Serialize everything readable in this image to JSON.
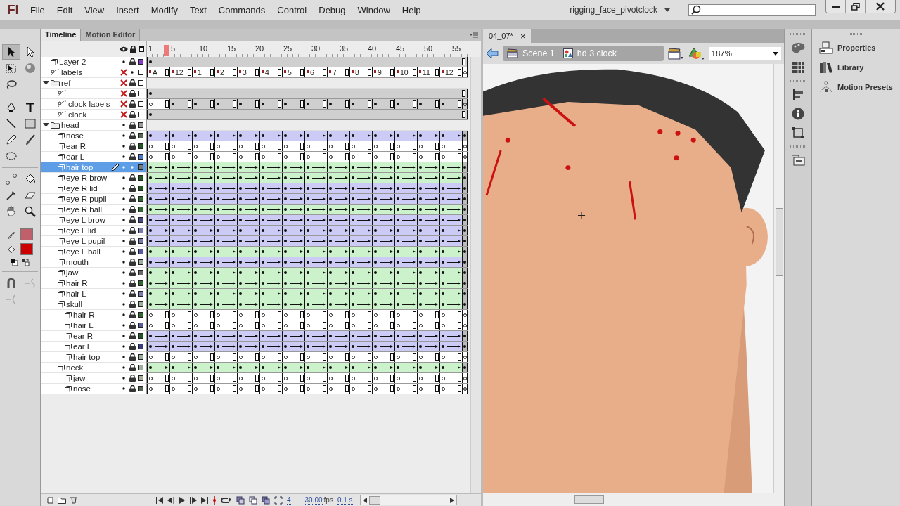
{
  "app": {
    "logo": "Fl",
    "menus": [
      "File",
      "Edit",
      "View",
      "Insert",
      "Modify",
      "Text",
      "Commands",
      "Control",
      "Debug",
      "Window",
      "Help"
    ],
    "workspace": "rigging_face_pivotclock"
  },
  "tools": {
    "stroke": {
      "color": "#c0606a"
    },
    "fill": {
      "color": "#cc0000"
    }
  },
  "timeline": {
    "tabs": [
      {
        "label": "Timeline",
        "selected": true
      },
      {
        "label": "Motion Editor",
        "selected": false
      }
    ],
    "ruler": [
      "1",
      "5",
      "10",
      "15",
      "20",
      "25",
      "30",
      "35",
      "40",
      "45",
      "50",
      "55"
    ],
    "frame_labels": [
      "A",
      "12",
      "1",
      "2",
      "3",
      "4",
      "5",
      "6",
      "7",
      "8",
      "9",
      "10",
      "11",
      "12"
    ],
    "layers": [
      {
        "name": "Layer 2",
        "kind": "layer",
        "hidden": false,
        "locked": true,
        "selected": false,
        "color": "#8a3cc8",
        "frames": {
          "kind": "static"
        }
      },
      {
        "name": "labels",
        "kind": "guide",
        "hidden": true,
        "locked": false,
        "selected": false,
        "color": "#ffffff",
        "frames": {
          "kind": "labels"
        }
      },
      {
        "name": "ref",
        "kind": "folder",
        "expanded": true,
        "hidden": true,
        "locked": true,
        "selected": false,
        "color": "#ffffff",
        "frames": {
          "kind": "none"
        },
        "children": [
          {
            "kind": "guide",
            "hidden": true,
            "locked": true,
            "selected": false,
            "color": "#ffffff",
            "frames": {
              "kind": "static"
            }
          },
          {
            "name": "clock labels",
            "kind": "guide",
            "hidden": true,
            "locked": true,
            "selected": false,
            "color": "#ffffff",
            "frames": {
              "kind": "keys"
            }
          },
          {
            "name": "clock",
            "kind": "guide",
            "hidden": true,
            "locked": true,
            "selected": false,
            "color": "#ffffff",
            "frames": {
              "kind": "static"
            }
          }
        ]
      },
      {
        "name": "head",
        "kind": "folder",
        "expanded": true,
        "hidden": false,
        "locked": true,
        "selected": false,
        "color": "#999999",
        "frames": {
          "kind": "none"
        },
        "children": [
          {
            "name": "nose",
            "kind": "layer",
            "hidden": false,
            "locked": true,
            "selected": false,
            "color": "#556655",
            "frames": {
              "kind": "classic-tween"
            }
          },
          {
            "name": "ear R",
            "kind": "layer",
            "hidden": false,
            "locked": true,
            "selected": false,
            "color": "#1e5a1e",
            "frames": {
              "kind": "empty"
            }
          },
          {
            "name": "ear L",
            "kind": "layer",
            "hidden": false,
            "locked": true,
            "selected": false,
            "color": "#4a7ad0",
            "frames": {
              "kind": "empty"
            }
          },
          {
            "name": "hair top",
            "kind": "layer",
            "hidden": false,
            "locked": false,
            "selected": true,
            "color": "#777777",
            "frames": {
              "kind": "shape-tween"
            }
          },
          {
            "name": "eye R brow",
            "kind": "layer",
            "hidden": false,
            "locked": true,
            "selected": false,
            "color": "#1e5a1e",
            "frames": {
              "kind": "shape-tween"
            }
          },
          {
            "name": "eye R lid",
            "kind": "layer",
            "hidden": false,
            "locked": true,
            "selected": false,
            "color": "#1e5a1e",
            "frames": {
              "kind": "classic-tween"
            }
          },
          {
            "name": "eye R pupil",
            "kind": "layer",
            "hidden": false,
            "locked": true,
            "selected": false,
            "color": "#2a6a2a",
            "frames": {
              "kind": "classic-tween"
            }
          },
          {
            "name": "eye R ball",
            "kind": "layer",
            "hidden": false,
            "locked": true,
            "selected": false,
            "color": "#2a6a2a",
            "frames": {
              "kind": "shape-tween"
            }
          },
          {
            "name": "eye L brow",
            "kind": "layer",
            "hidden": false,
            "locked": true,
            "selected": false,
            "color": "#4a4a8a",
            "frames": {
              "kind": "classic-tween"
            }
          },
          {
            "name": "eye L lid",
            "kind": "layer",
            "hidden": false,
            "locked": true,
            "selected": false,
            "color": "#7a7ab0",
            "frames": {
              "kind": "classic-tween"
            }
          },
          {
            "name": "eye L pupil",
            "kind": "layer",
            "hidden": false,
            "locked": true,
            "selected": false,
            "color": "#7a7ab0",
            "frames": {
              "kind": "classic-tween"
            }
          },
          {
            "name": "eye L ball",
            "kind": "layer",
            "hidden": false,
            "locked": true,
            "selected": false,
            "color": "#5a5aa0",
            "frames": {
              "kind": "shape-tween"
            }
          },
          {
            "name": "mouth",
            "kind": "layer",
            "hidden": false,
            "locked": true,
            "selected": false,
            "color": "#9ab09a",
            "frames": {
              "kind": "classic-tween"
            }
          },
          {
            "name": "jaw",
            "kind": "layer",
            "hidden": false,
            "locked": true,
            "selected": false,
            "color": "#6a6a6a",
            "frames": {
              "kind": "shape-tween"
            }
          },
          {
            "name": "hair R",
            "kind": "layer",
            "hidden": false,
            "locked": true,
            "selected": false,
            "color": "#2a6a2a",
            "frames": {
              "kind": "shape-tween"
            }
          },
          {
            "name": "hair L",
            "kind": "layer",
            "hidden": false,
            "locked": true,
            "selected": false,
            "color": "#7a7ab0",
            "frames": {
              "kind": "shape-tween"
            }
          },
          {
            "name": "skull",
            "kind": "layer",
            "hidden": false,
            "locked": true,
            "selected": false,
            "color": "#9ab09a",
            "frames": {
              "kind": "shape-tween"
            },
            "children": [
              {
                "name": "hair R",
                "kind": "layer",
                "hidden": false,
                "locked": true,
                "selected": false,
                "color": "#2a6a2a",
                "frames": {
                  "kind": "empty"
                }
              },
              {
                "name": "hair L",
                "kind": "layer",
                "hidden": false,
                "locked": true,
                "selected": false,
                "color": "#5a5aa0",
                "frames": {
                  "kind": "empty"
                }
              },
              {
                "name": "ear R",
                "kind": "layer",
                "hidden": false,
                "locked": true,
                "selected": false,
                "color": "#1e5a1e",
                "frames": {
                  "kind": "classic-tween"
                }
              },
              {
                "name": "ear L",
                "kind": "layer",
                "hidden": false,
                "locked": true,
                "selected": false,
                "color": "#3a3a80",
                "frames": {
                  "kind": "classic-tween"
                }
              },
              {
                "name": "hair top",
                "kind": "layer",
                "hidden": false,
                "locked": true,
                "selected": false,
                "color": "#9ab09a",
                "frames": {
                  "kind": "empty"
                }
              }
            ]
          },
          {
            "name": "neck",
            "kind": "layer",
            "hidden": false,
            "locked": true,
            "selected": false,
            "color": "#9ab09a",
            "frames": {
              "kind": "shape-tween"
            },
            "children": [
              {
                "name": "jaw",
                "kind": "layer",
                "hidden": false,
                "locked": true,
                "selected": false,
                "color": "#aab09a",
                "frames": {
                  "kind": "empty"
                }
              },
              {
                "name": "nose",
                "kind": "layer",
                "hidden": false,
                "locked": true,
                "selected": false,
                "color": "#556655",
                "frames": {
                  "kind": "empty"
                }
              }
            ]
          }
        ]
      }
    ],
    "footer": {
      "frame": "4",
      "fps": "30.00",
      "fps_unit": "fps",
      "time": "0.1 s"
    }
  },
  "document": {
    "tab": "04_07*",
    "close": "×",
    "breadcrumbs": [
      {
        "label": "Scene 1",
        "kind": "scene"
      },
      {
        "label": "hd 3 clock",
        "kind": "symbol"
      }
    ],
    "zoom": "187%"
  },
  "panels": [
    {
      "label": "Properties",
      "kind": "properties"
    },
    {
      "label": "Library",
      "kind": "library"
    },
    {
      "label": "Motion Presets",
      "kind": "presets"
    }
  ]
}
